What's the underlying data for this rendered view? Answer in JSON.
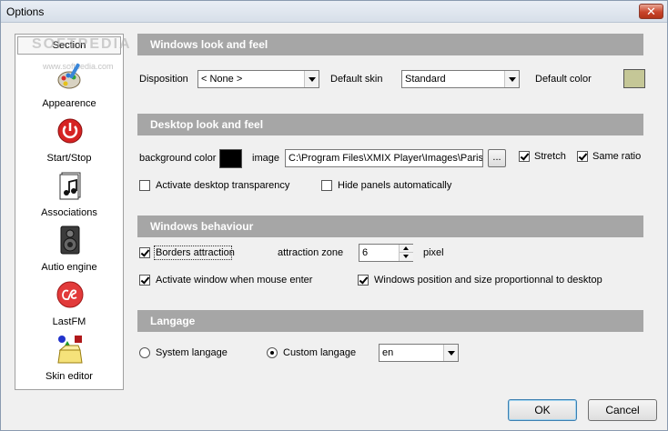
{
  "window": {
    "title": "Options",
    "close_symbol": "✕"
  },
  "sidebar": {
    "header": "Section",
    "watermark": "SOFTPEDIA",
    "watermark_url": "www.softpedia.com",
    "items": [
      {
        "label": "Appearence",
        "icon": "palette-brush-icon"
      },
      {
        "label": "Start/Stop",
        "icon": "power-icon"
      },
      {
        "label": "Associations",
        "icon": "music-file-icon"
      },
      {
        "label": "Autio engine",
        "icon": "speaker-icon"
      },
      {
        "label": "LastFM",
        "icon": "lastfm-icon"
      },
      {
        "label": "Skin editor",
        "icon": "shapes-box-icon"
      }
    ]
  },
  "windows_look": {
    "header": "Windows look and feel",
    "disposition_label": "Disposition",
    "disposition_value": "< None >",
    "default_skin_label": "Default skin",
    "default_skin_value": "Standard",
    "default_color_label": "Default color",
    "default_color_hex": "#c5c797"
  },
  "desktop_look": {
    "header": "Desktop look and feel",
    "background_color_label": "background color",
    "background_color_hex": "#000000",
    "image_label": "image",
    "image_path": "C:\\Program Files\\XMIX Player\\Images\\Paris_",
    "browse_label": "...",
    "stretch_label": "Stretch",
    "stretch_checked": true,
    "same_ratio_label": "Same ratio",
    "same_ratio_checked": true,
    "transparency_label": "Activate desktop transparency",
    "transparency_checked": false,
    "hide_panels_label": "Hide panels automatically",
    "hide_panels_checked": false
  },
  "windows_behaviour": {
    "header": "Windows behaviour",
    "borders_attraction_label": "Borders attraction",
    "borders_attraction_checked": true,
    "attraction_zone_label": "attraction zone",
    "attraction_zone_value": "6",
    "pixel_label": "pixel",
    "activate_window_label": "Activate window when mouse enter",
    "activate_window_checked": true,
    "proportional_label": "Windows position and size proportionnal to desktop",
    "proportional_checked": true
  },
  "langage": {
    "header": "Langage",
    "system_label": "System langage",
    "custom_label": "Custom langage",
    "selected": "custom",
    "custom_value": "en"
  },
  "footer": {
    "ok_label": "OK",
    "cancel_label": "Cancel"
  },
  "colors": {
    "section_header": "#a6a6a6",
    "accent": "#3c7fb1"
  }
}
